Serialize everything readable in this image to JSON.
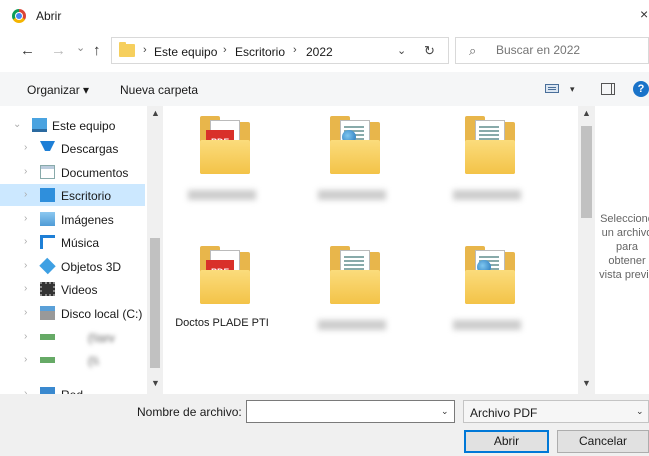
{
  "window": {
    "title": "Abrir",
    "close_glyph": "×"
  },
  "nav": {
    "back": "←",
    "forward": "→",
    "recent": "⌄",
    "up": "↑"
  },
  "address": {
    "crumbs": [
      "Este equipo",
      "Escritorio",
      "2022"
    ],
    "sep": "›",
    "dropdown": "⌄",
    "refresh": "↻"
  },
  "search": {
    "icon": "⌕",
    "placeholder": "Buscar en 2022"
  },
  "toolbar": {
    "organize": "Organizar ▾",
    "new_folder": "Nueva carpeta",
    "view_dd": "▾",
    "help": "?"
  },
  "sidebar": {
    "items": [
      {
        "label": "Este equipo",
        "icon": "pc-icon",
        "expanded": true,
        "selected": false,
        "blurred": false
      },
      {
        "label": "Descargas",
        "icon": "downloads-icon",
        "selected": false,
        "blurred": false
      },
      {
        "label": "Documentos",
        "icon": "documents-icon",
        "selected": false,
        "blurred": false
      },
      {
        "label": "Escritorio",
        "icon": "desktop-icon",
        "selected": true,
        "blurred": false
      },
      {
        "label": "Imágenes",
        "icon": "pictures-icon",
        "selected": false,
        "blurred": false
      },
      {
        "label": "Música",
        "icon": "music-icon",
        "selected": false,
        "blurred": false
      },
      {
        "label": "Objetos 3D",
        "icon": "3d-objects-icon",
        "selected": false,
        "blurred": false
      },
      {
        "label": "Videos",
        "icon": "videos-icon",
        "selected": false,
        "blurred": false
      },
      {
        "label": "Disco local (C:)",
        "icon": "drive-icon",
        "selected": false,
        "blurred": false
      },
      {
        "label": "(\\\\srv",
        "icon": "network-drive-icon",
        "selected": false,
        "blurred": true
      },
      {
        "label": "(\\\\",
        "icon": "network-drive-icon",
        "selected": false,
        "blurred": true
      },
      {
        "label": "Red",
        "icon": "network-icon",
        "selected": false,
        "blurred": false
      }
    ]
  },
  "files": [
    {
      "name": "",
      "type": "pdf",
      "blurred": true
    },
    {
      "name": "",
      "type": "web",
      "blurred": true
    },
    {
      "name": "",
      "type": "doc",
      "blurred": true
    },
    {
      "name": "Doctos PLADE PTI",
      "type": "pdf",
      "blurred": false
    },
    {
      "name": "",
      "type": "doc",
      "blurred": true
    },
    {
      "name": "",
      "type": "web",
      "blurred": true
    }
  ],
  "preview": {
    "message": "Seleccione\nun archivo\npara\nobtener\nvista previa"
  },
  "footer": {
    "filename_label": "Nombre de archivo:",
    "filename_value": "",
    "filetype": "Archivo PDF",
    "dropdown": "⌄",
    "open": "Abrir",
    "cancel": "Cancelar"
  },
  "scroll": {
    "up": "▲",
    "down": "▼"
  }
}
